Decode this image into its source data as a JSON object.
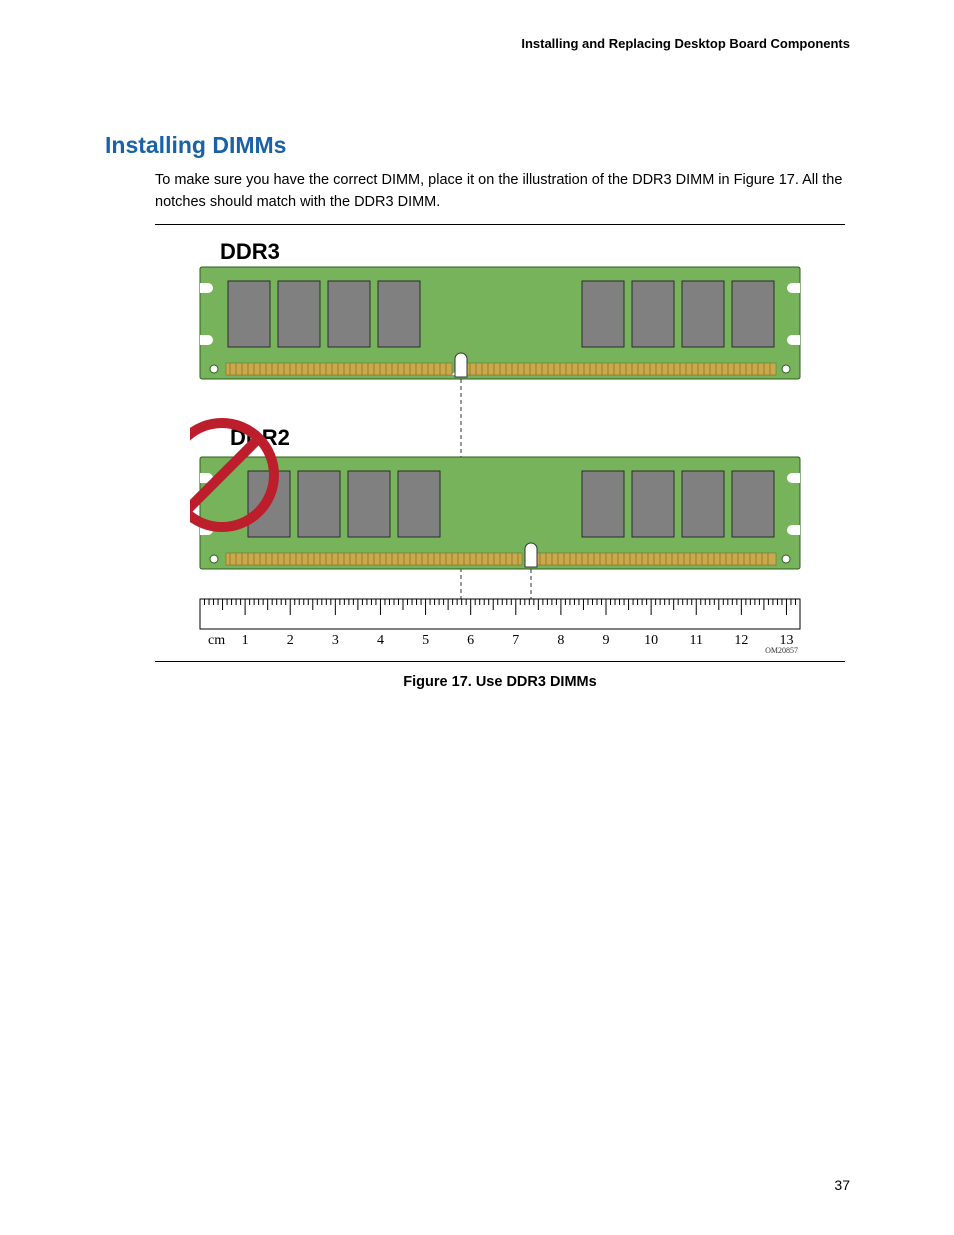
{
  "header": {
    "breadcrumb": "Installing and Replacing Desktop Board Components"
  },
  "heading": "Installing DIMMs",
  "paragraph": "To make sure you have the correct DIMM, place it on the illustration of the DDR3 DIMM in Figure 17.  All the notches should match with the DDR3 DIMM.",
  "figure": {
    "label_ddr3": "DDR3",
    "label_ddr2": "DDR2",
    "ruler_unit": "cm",
    "ruler_marks": [
      "1",
      "2",
      "3",
      "4",
      "5",
      "6",
      "7",
      "8",
      "9",
      "10",
      "11",
      "12",
      "13"
    ],
    "part_no": "OM20857",
    "caption": "Figure 17.  Use DDR3 DIMMs"
  },
  "page_number": "37"
}
